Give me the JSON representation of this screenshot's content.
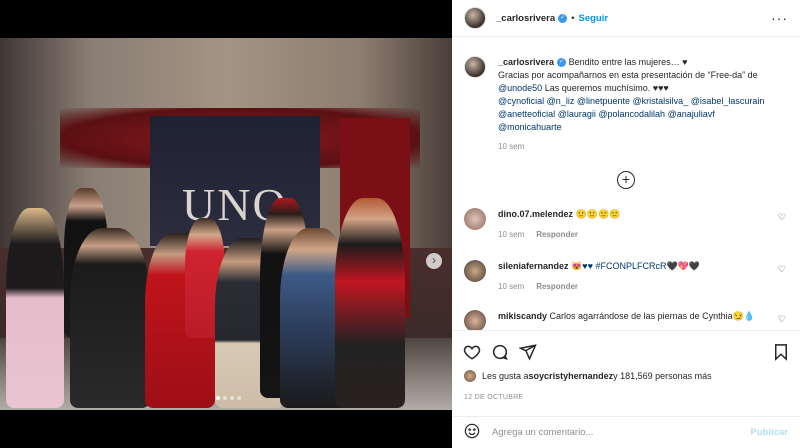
{
  "post": {
    "username": "_carlosrivera",
    "follow_label": "Seguir",
    "separator": "•",
    "more_label": "···",
    "photo_banner_text": "UNO",
    "photo_next_label": "›"
  },
  "caption": {
    "username": "_carlosrivera",
    "line1": "Bendito entre las mujeres… ♥",
    "line2a": "Gracias por acompañarnos en esta presentación de “Free-da” de",
    "mention_unode50": "@unode50",
    "line2b": " Las queremos muchísimo. ♥♥♥",
    "mentions_1": [
      "@cynoficial",
      "@n_liz",
      "@linetpuente",
      "@kristalsilva_",
      "@isabel_lascurain"
    ],
    "mentions_2": [
      "@anetteoficial",
      "@lauragii",
      "@polancodalilah",
      "@anajuliavf"
    ],
    "mentions_3": [
      "@monicahuarte"
    ],
    "time": "10 sem"
  },
  "load_more_label": "+",
  "comments": [
    {
      "username": "dino.07.melendez",
      "text": "🙂🙂🙂🙂",
      "time": "10 sem",
      "reply": "Responder"
    },
    {
      "username": "sileniafernandez",
      "text": "😻♥♥ #FCONPLFCRсR🖤💖🖤",
      "time": "10 sem",
      "reply": "Responder"
    },
    {
      "username": "mikiscandy",
      "text": "Carlos agarrándose de las piernas de Cynthia😏💧"
    }
  ],
  "actions": {
    "like_icon": "heart-icon",
    "comment_icon": "comment-icon",
    "share_icon": "share-icon",
    "save_icon": "bookmark-icon"
  },
  "likes": {
    "prefix": "Les gusta a ",
    "user": "soycristyhernandez",
    "suffix": " y 181,569 personas más"
  },
  "date": "12 DE OCTUBRE",
  "add_comment": {
    "placeholder": "Agrega un comentario...",
    "publish": "Publicar"
  },
  "colors": {
    "accent": "#0095f6",
    "link": "#00376b",
    "muted": "#8e8e8e",
    "publish_disabled": "#b2dffc",
    "verified": "#3897f0"
  }
}
